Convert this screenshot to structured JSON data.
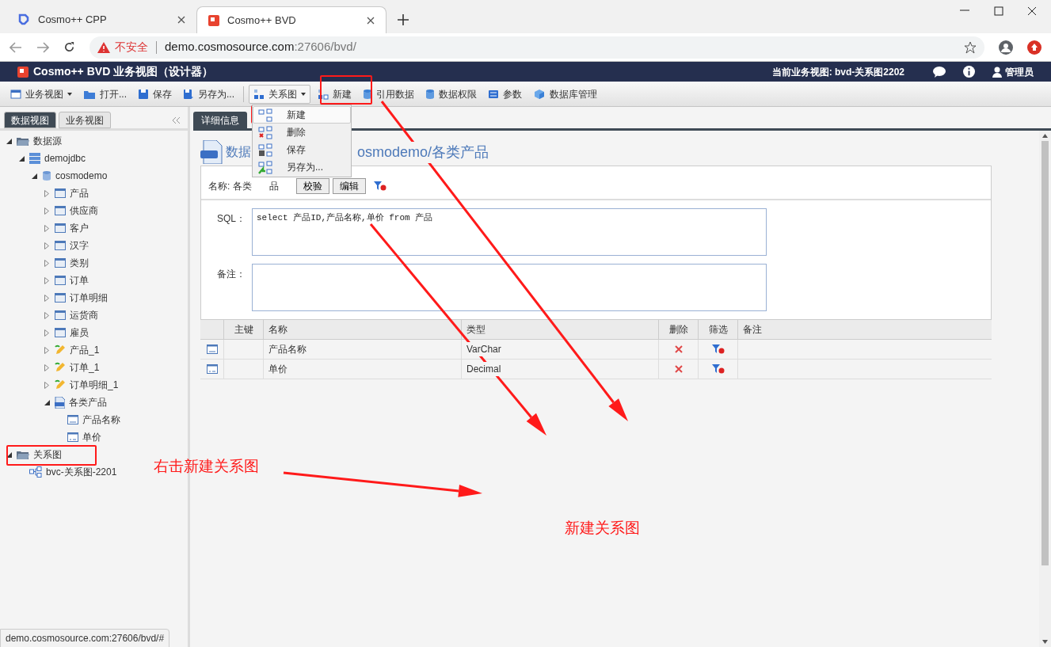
{
  "browser": {
    "tabs": [
      {
        "title": "Cosmo++ CPP",
        "selected": false
      },
      {
        "title": "Cosmo++ BVD",
        "selected": true
      }
    ],
    "address": {
      "warning": "不安全",
      "host": "demo.cosmosource.com",
      "path": ":27606/bvd/"
    },
    "status_url": "demo.cosmosource.com:27606/bvd/#"
  },
  "app_header": {
    "title": "Cosmo++ BVD 业务视图（设计器）",
    "current_view": "当前业务视图: bvd-关系图2202",
    "user": "管理员"
  },
  "toolbar": [
    {
      "label": "业务视图",
      "kind": "view",
      "dropdown": true,
      "pressed": false
    },
    {
      "label": "打开...",
      "kind": "open",
      "dropdown": false,
      "pressed": false
    },
    {
      "label": "保存",
      "kind": "save",
      "dropdown": false,
      "pressed": false
    },
    {
      "label": "另存为...",
      "kind": "saveas",
      "dropdown": false,
      "pressed": false
    },
    {
      "label": "关系图",
      "kind": "diagram",
      "dropdown": true,
      "pressed": true
    },
    {
      "label": "新建",
      "kind": "new",
      "dropdown": false,
      "pressed": false
    },
    {
      "label": "引用数据",
      "kind": "db",
      "dropdown": false,
      "pressed": false
    },
    {
      "label": "数据权限",
      "kind": "db",
      "dropdown": false,
      "pressed": false
    },
    {
      "label": "参数",
      "kind": "param",
      "dropdown": false,
      "pressed": false
    },
    {
      "label": "数据库管理",
      "kind": "cube",
      "dropdown": false,
      "pressed": false
    }
  ],
  "diagram_menu": [
    {
      "label": "新建",
      "kind": "new",
      "selected": true
    },
    {
      "label": "删除",
      "kind": "delete",
      "selected": false
    },
    {
      "label": "保存",
      "kind": "save",
      "selected": false
    },
    {
      "label": "另存为...",
      "kind": "saveas",
      "selected": false
    }
  ],
  "sidebar": {
    "tabs": [
      {
        "label": "数据视图",
        "selected": true
      },
      {
        "label": "业务视图",
        "selected": false
      }
    ],
    "tree": [
      {
        "label": "数据源",
        "kind": "folder",
        "expanded": true,
        "children": [
          {
            "label": "demojdbc",
            "kind": "server",
            "expanded": true,
            "children": [
              {
                "label": "cosmodemo",
                "kind": "database",
                "expanded": true,
                "children": [
                  {
                    "label": "产品",
                    "kind": "table",
                    "expanded": false
                  },
                  {
                    "label": "供应商",
                    "kind": "table",
                    "expanded": false
                  },
                  {
                    "label": "客户",
                    "kind": "table",
                    "expanded": false
                  },
                  {
                    "label": "汉字",
                    "kind": "table",
                    "expanded": false
                  },
                  {
                    "label": "类别",
                    "kind": "table",
                    "expanded": false
                  },
                  {
                    "label": "订单",
                    "kind": "table",
                    "expanded": false
                  },
                  {
                    "label": "订单明细",
                    "kind": "table",
                    "expanded": false
                  },
                  {
                    "label": "运货商",
                    "kind": "table",
                    "expanded": false
                  },
                  {
                    "label": "雇员",
                    "kind": "table",
                    "expanded": false
                  },
                  {
                    "label": "产品_1",
                    "kind": "view",
                    "expanded": false
                  },
                  {
                    "label": "订单_1",
                    "kind": "view",
                    "expanded": false
                  },
                  {
                    "label": "订单明细_1",
                    "kind": "view",
                    "expanded": false
                  },
                  {
                    "label": "各类产品",
                    "kind": "sql",
                    "expanded": true,
                    "children": [
                      {
                        "label": "产品名称",
                        "kind": "text_field"
                      },
                      {
                        "label": "单价",
                        "kind": "number_field"
                      }
                    ]
                  }
                ]
              }
            ]
          }
        ]
      },
      {
        "label": "关系图",
        "kind": "folder",
        "expanded": true,
        "children": [
          {
            "label": "bvc-关系图-2201",
            "kind": "diagram"
          }
        ]
      }
    ]
  },
  "detail": {
    "tab": "详细信息",
    "title_start": "数据",
    "title_end": "osmodemo/各类产品",
    "name_label_start": "名称: 各类",
    "name_label_end": "品",
    "buttons": [
      "校验",
      "编辑"
    ],
    "sql_label": "SQL：",
    "sql": "select 产品ID,产品名称,单价 from 产品",
    "note_label": "备注：",
    "columns": [
      "主键",
      "名称",
      "类型",
      "删除",
      "筛选",
      "备注"
    ],
    "rows": [
      {
        "kind": "text",
        "name": "产品名称",
        "type": "VarChar"
      },
      {
        "kind": "number",
        "name": "单价",
        "type": "Decimal"
      }
    ]
  },
  "annotations": [
    {
      "text": "右击新建关系图"
    },
    {
      "text": "新建关系图"
    }
  ]
}
